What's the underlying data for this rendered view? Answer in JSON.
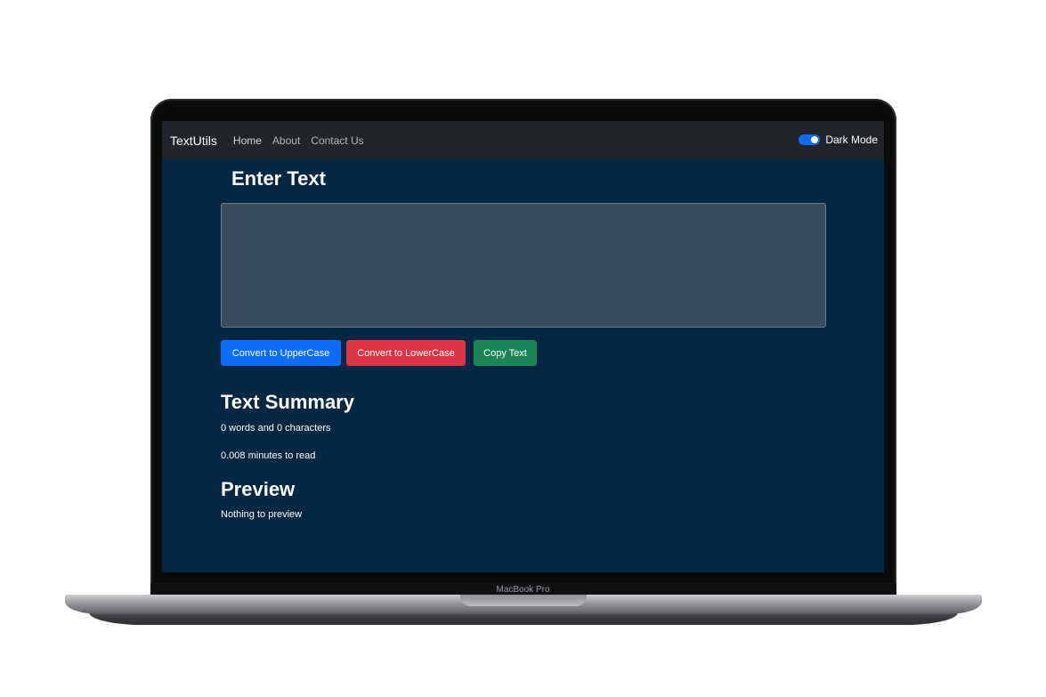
{
  "navbar": {
    "brand": "TextUtils",
    "links": [
      "Home",
      "About",
      "Contact Us"
    ],
    "toggle_label": "Dark Mode"
  },
  "form": {
    "heading": "Enter Text",
    "textarea_value": ""
  },
  "buttons": {
    "upper": "Convert to UpperCase",
    "lower": "Convert to LowerCase",
    "copy": "Copy Text"
  },
  "summary": {
    "title": "Text Summary",
    "words_line": "0 words and 0 characters",
    "minutes_line": "0.008 minutes to read"
  },
  "preview": {
    "title": "Preview",
    "text": "Nothing to preview"
  },
  "device": {
    "label": "MacBook Pro"
  },
  "colors": {
    "background": "#042743",
    "navbar": "#212529",
    "primary": "#0d6efd",
    "danger": "#dc3545",
    "success": "#198754"
  }
}
